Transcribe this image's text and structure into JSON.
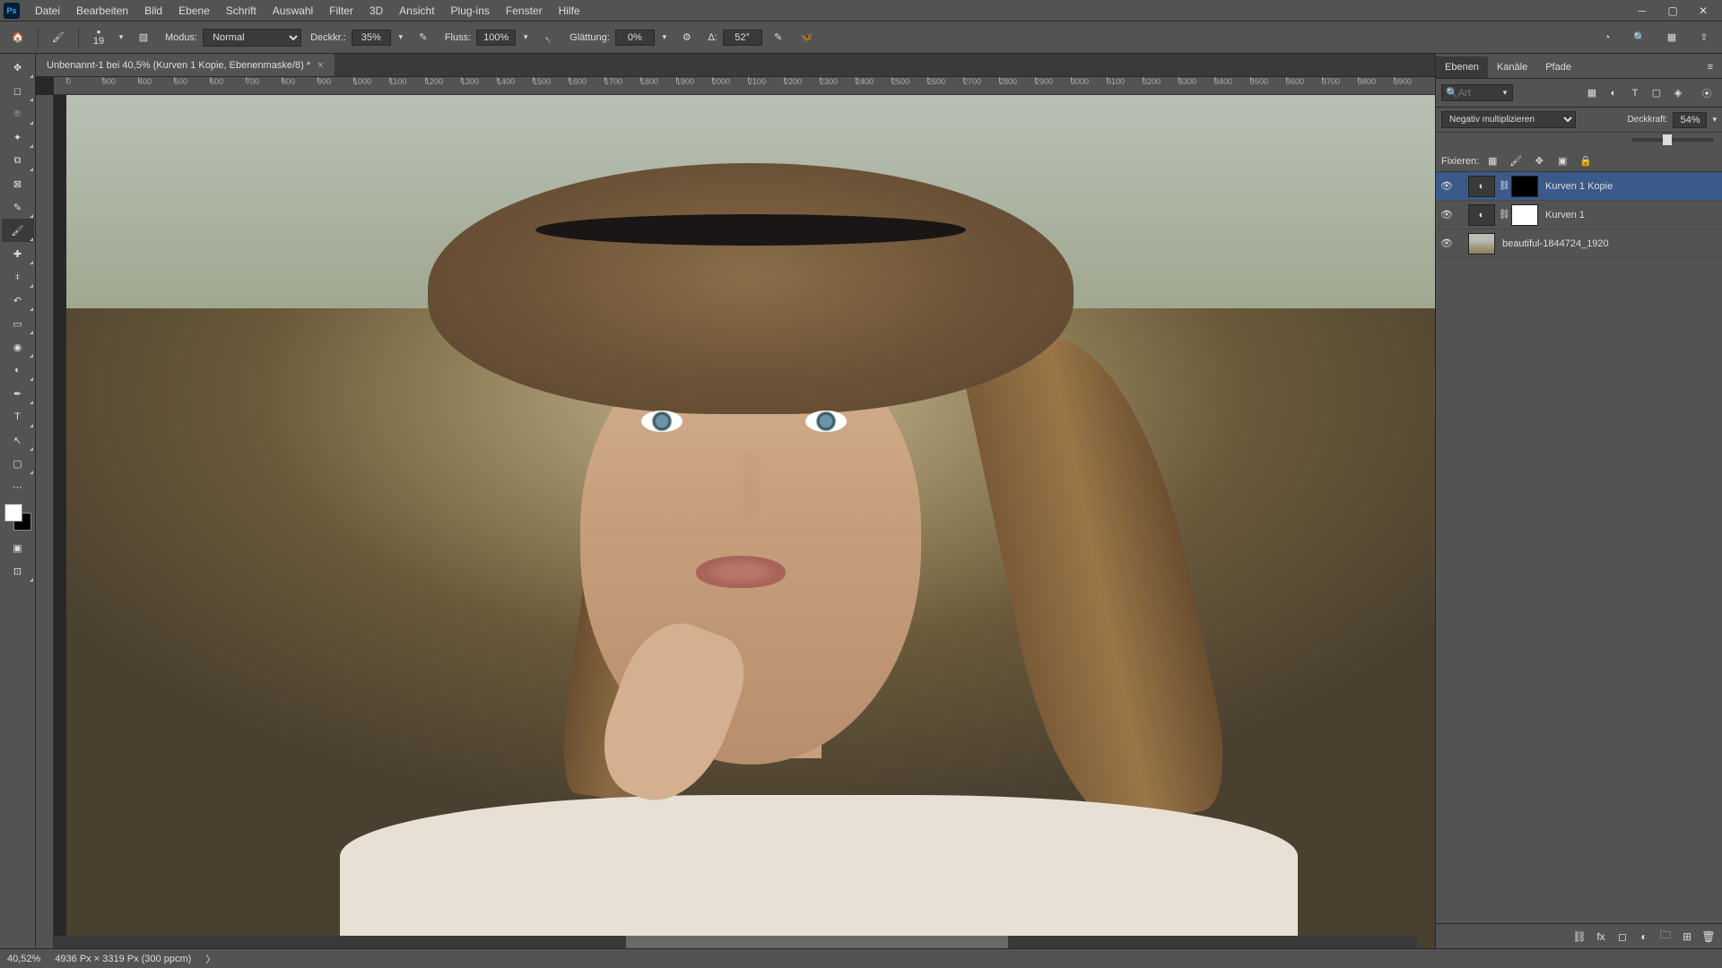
{
  "app": {
    "logo": "Ps"
  },
  "menu": [
    "Datei",
    "Bearbeiten",
    "Bild",
    "Ebene",
    "Schrift",
    "Auswahl",
    "Filter",
    "3D",
    "Ansicht",
    "Plug-ins",
    "Fenster",
    "Hilfe"
  ],
  "optbar": {
    "brush_size": "19",
    "mode_label": "Modus:",
    "mode_value": "Normal",
    "deckk_label": "Deckkr.:",
    "deckk_value": "35%",
    "fluss_label": "Fluss:",
    "fluss_value": "100%",
    "glatt_label": "Glättung:",
    "glatt_value": "0%",
    "angle_label": "∆:",
    "angle_value": "52°"
  },
  "doc": {
    "title": "Unbenannt-1 bei 40,5% (Kurven 1 Kopie, Ebenenmaske/8) *"
  },
  "ruler_ticks": [
    "0",
    "300",
    "400",
    "500",
    "600",
    "700",
    "800",
    "900",
    "1000",
    "1100",
    "1200",
    "1300",
    "1400",
    "1500",
    "1600",
    "1700",
    "1800",
    "1900",
    "2000",
    "2100",
    "2200",
    "2300",
    "2400",
    "2500",
    "2600",
    "2700",
    "2800",
    "2900",
    "3000",
    "3100",
    "3200",
    "3300",
    "3400",
    "3500",
    "3600",
    "3700",
    "3800",
    "3900"
  ],
  "panel": {
    "tabs": [
      "Ebenen",
      "Kanäle",
      "Pfade"
    ],
    "search_placeholder": "Art",
    "blend_mode": "Negativ multiplizieren",
    "opacity_label": "Deckkraft:",
    "opacity_value": "54%",
    "lock_label": "Fixieren:",
    "layers": [
      {
        "name": "Kurven 1 Kopie",
        "type": "adj",
        "selected": true
      },
      {
        "name": "Kurven 1",
        "type": "adj",
        "selected": false
      },
      {
        "name": "beautiful-1844724_1920",
        "type": "img",
        "selected": false
      }
    ]
  },
  "status": {
    "zoom": "40,52%",
    "dims": "4936 Px × 3319 Px (300 ppcm)"
  }
}
